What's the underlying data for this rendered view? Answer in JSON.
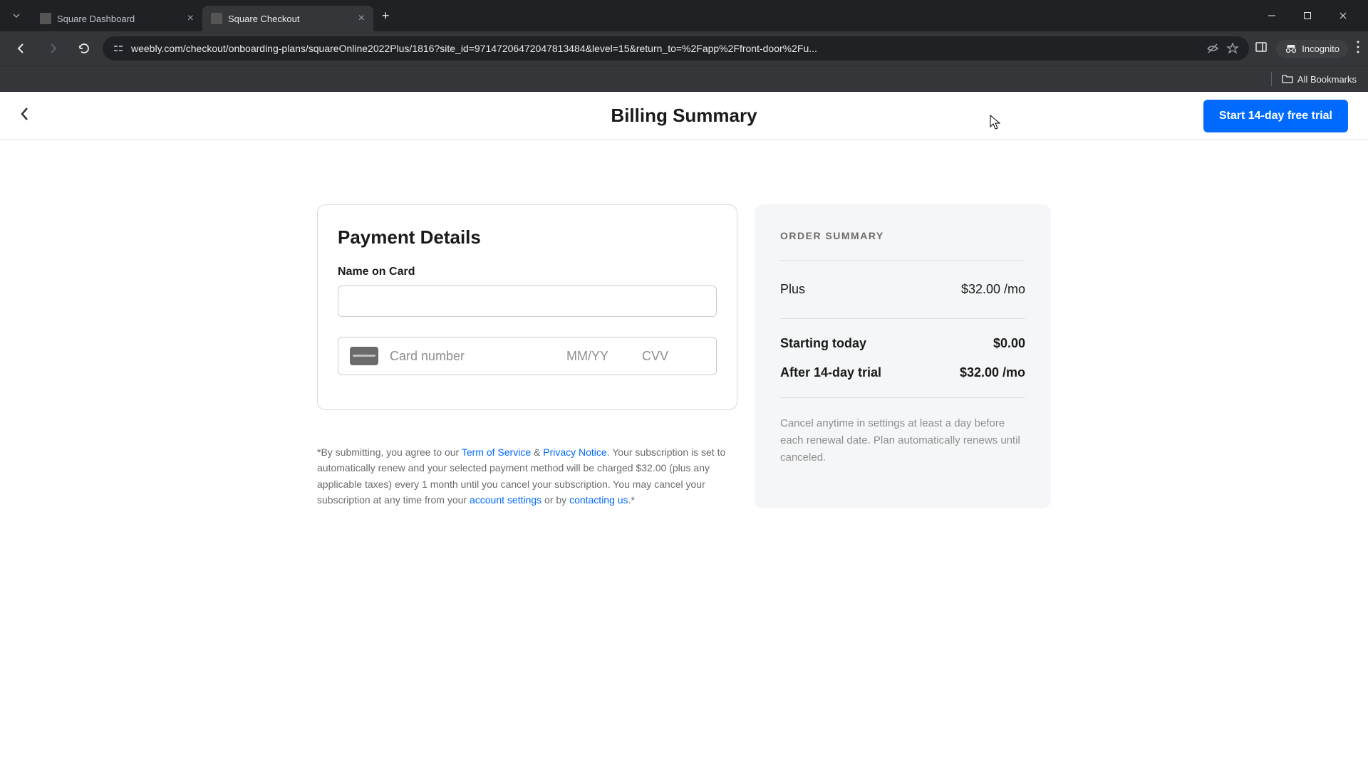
{
  "browser": {
    "tabs": [
      {
        "title": "Square Dashboard",
        "active": false
      },
      {
        "title": "Square Checkout",
        "active": true
      }
    ],
    "url": "weebly.com/checkout/onboarding-plans/squareOnline2022Plus/1816?site_id=97147206472047813484&level=15&return_to=%2Fapp%2Ffront-door%2Fu...",
    "incognito_label": "Incognito",
    "all_bookmarks": "All Bookmarks"
  },
  "header": {
    "title": "Billing Summary",
    "cta": "Start 14-day free trial"
  },
  "payment": {
    "heading": "Payment Details",
    "name_label": "Name on Card",
    "name_value": "",
    "card_placeholder": "Card number",
    "expiry_placeholder": "MM/YY",
    "cvv_placeholder": "CVV"
  },
  "summary": {
    "heading": "ORDER SUMMARY",
    "plan_name": "Plus",
    "plan_price": "$32.00 /mo",
    "today_label": "Starting today",
    "today_value": "$0.00",
    "after_label": "After 14-day trial",
    "after_value": "$32.00 /mo",
    "note": "Cancel anytime in settings at least a day before each renewal date. Plan automatically renews until canceled."
  },
  "legal": {
    "pre": "*By submitting, you agree to our ",
    "tos": "Term of Service",
    "amp": " & ",
    "privacy": "Privacy Notice",
    "mid1": ". Your subscription is set to automatically renew and your selected payment method will be charged $32.00 (plus any applicable taxes) every 1 month until you cancel your subscription. You may cancel your subscription at any time from your ",
    "account": "account settings",
    "mid2": " or by ",
    "contact": "contacting us",
    "end": ".*"
  }
}
